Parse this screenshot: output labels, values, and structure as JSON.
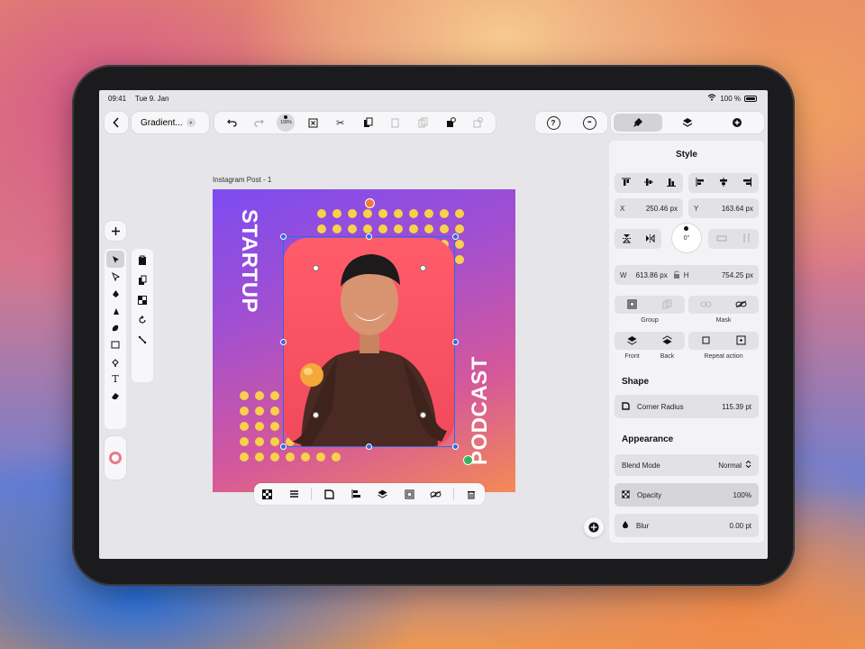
{
  "status": {
    "time": "09:41",
    "date": "Tue 9. Jan",
    "battery": "100 %"
  },
  "toolbar": {
    "back_icon": "chevron-left-icon",
    "document_name": "Gradient...",
    "zoom": "100%",
    "icons": [
      "undo-icon",
      "redo-icon",
      "zoom-icon",
      "select-frame-icon",
      "cut-icon",
      "copy-icon",
      "paste-icon",
      "duplicate-icon",
      "lock-icon",
      "unlock-icon"
    ]
  },
  "help": {
    "question": "?",
    "more": "•••"
  },
  "panel_tabs": [
    "style-tab",
    "layers-tab",
    "export-tab"
  ],
  "canvas": {
    "artboard_label": "Instagram Post - 1",
    "title_vertical_1": "STARTUP",
    "title_vertical_2": "PODCAST",
    "colors": {
      "gradient_start": "#7d4cf0",
      "gradient_end": "#f48a55",
      "dots": "#f8d14a",
      "photo_bg": "#ff5c6a",
      "selection": "#2f6bdc"
    }
  },
  "inspector": {
    "title": "Style",
    "x_label": "X",
    "x_value": "250.46 px",
    "y_label": "Y",
    "y_value": "163.64 px",
    "rotation": "0°",
    "w_label": "W",
    "w_value": "613.86 px",
    "h_label": "H",
    "h_value": "754.25 px",
    "group_label": "Group",
    "mask_label": "Mask",
    "front_label": "Front",
    "back_label": "Back",
    "repeat_label": "Repeat action",
    "shape_section": "Shape",
    "corner_radius_label": "Corner Radius",
    "corner_radius_value": "115.39 pt",
    "appearance_section": "Appearance",
    "blend_label": "Blend Mode",
    "blend_value": "Normal",
    "opacity_label": "Opacity",
    "opacity_value": "100%",
    "blur_label": "Blur",
    "blur_value": "0.00 pt"
  }
}
